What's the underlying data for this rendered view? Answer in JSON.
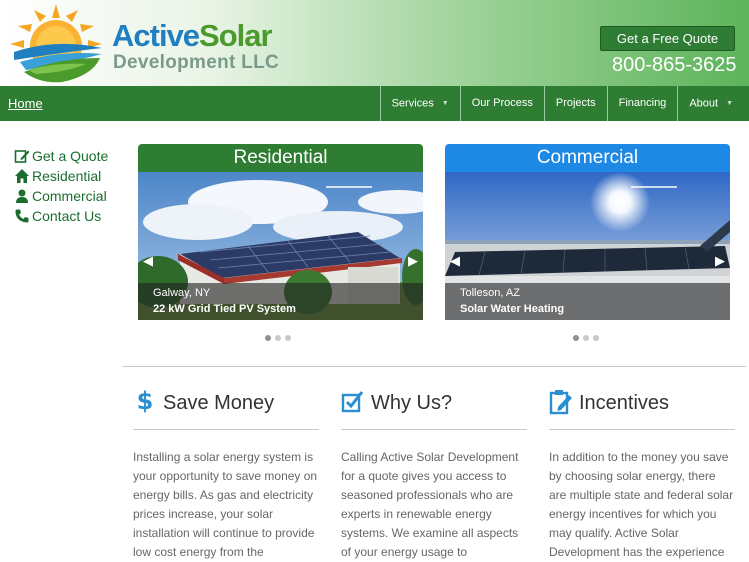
{
  "header": {
    "brand_active": "Active",
    "brand_solar": "Solar",
    "brand_sub": "Development LLC",
    "quote_button": "Get a Free Quote",
    "phone": "800-865-3625"
  },
  "nav": {
    "home": "Home",
    "items": [
      {
        "label": "Services",
        "dropdown": true
      },
      {
        "label": "Our Process",
        "dropdown": false
      },
      {
        "label": "Projects",
        "dropdown": false
      },
      {
        "label": "Financing",
        "dropdown": false
      },
      {
        "label": "About",
        "dropdown": true
      }
    ]
  },
  "sidebar": {
    "items": [
      {
        "label": "Get a Quote",
        "icon": "edit-icon"
      },
      {
        "label": "Residential",
        "icon": "home-icon"
      },
      {
        "label": "Commercial",
        "icon": "user-icon"
      },
      {
        "label": "Contact Us",
        "icon": "phone-icon"
      }
    ]
  },
  "cards": [
    {
      "title": "Residential",
      "location": "Galway, NY",
      "description": "22 kW Grid Tied PV System",
      "color": "#2e7d32"
    },
    {
      "title": "Commercial",
      "location": "Tolleson, AZ",
      "description": "Solar Water Heating",
      "color": "#1e88e5"
    }
  ],
  "features": [
    {
      "title": "Save Money",
      "icon": "dollar-icon",
      "text": "Installing a solar energy system is your opportunity to save money on energy bills. As gas and electricity prices increase, your solar installation will continue to provide low cost energy from the"
    },
    {
      "title": "Why Us?",
      "icon": "checkbox-icon",
      "text": "Calling Active Solar Development for a quote gives you access to seasoned professionals who are experts in renewable energy systems. We examine all aspects of your energy usage to"
    },
    {
      "title": "Incentives",
      "icon": "clipboard-edit-icon",
      "text": "In addition to the money you save by choosing solar energy, there are multiple state and federal solar energy incentives for which you may qualify. Active Solar Development has the experience"
    }
  ],
  "colors": {
    "green": "#2e7d32",
    "blue": "#1e88e5",
    "brand_blue": "#1f7fc0",
    "brand_green": "#4a9a2c"
  }
}
